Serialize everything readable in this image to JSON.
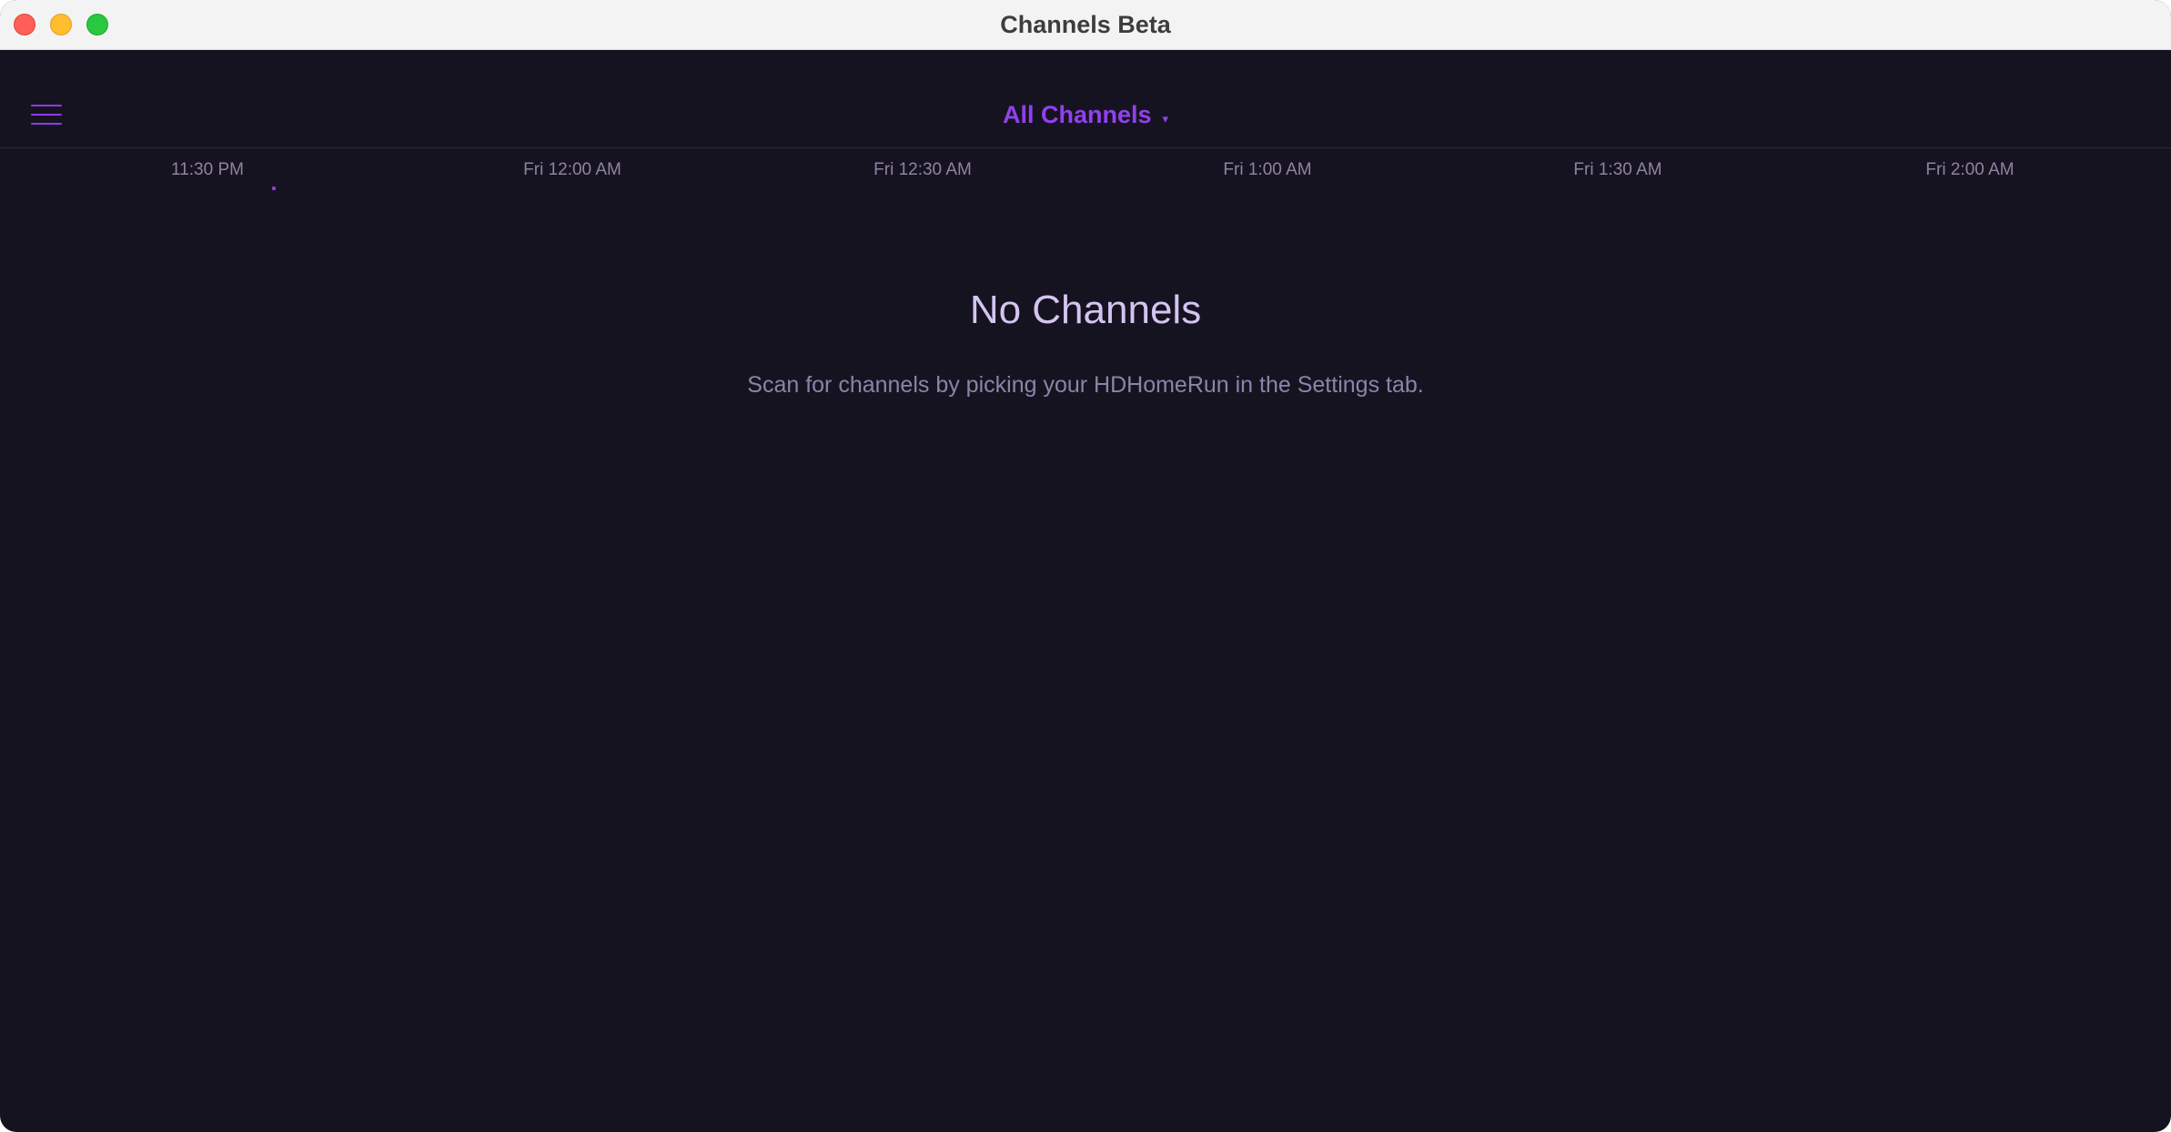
{
  "window": {
    "title": "Channels Beta"
  },
  "header": {
    "channel_picker_label": "All Channels",
    "caret": "▾"
  },
  "guide": {
    "time_slots": [
      "11:30 PM",
      "Fri 12:00 AM",
      "Fri 12:30 AM",
      "Fri 1:00 AM",
      "Fri 1:30 AM",
      "Fri 2:00 AM"
    ]
  },
  "empty_state": {
    "title": "No Channels",
    "message": "Scan for channels by picking your HDHomeRun in the Settings tab."
  },
  "colors": {
    "accent": "#9140ef",
    "background": "#161320",
    "muted_text": "#8e83a2",
    "title_text": "#d3c4f0"
  },
  "icons": {
    "menu": "hamburger-menu-icon",
    "caret": "caret-down-icon"
  }
}
